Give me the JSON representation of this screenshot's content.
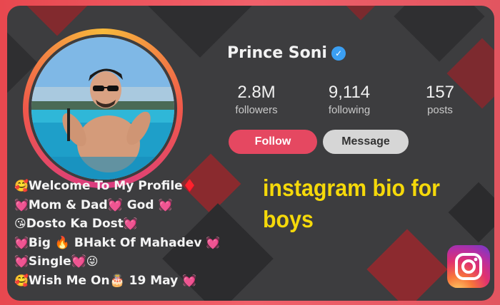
{
  "profile": {
    "username": "Prince Soni",
    "verified_icon": "verified-badge-icon"
  },
  "stats": [
    {
      "value": "2.8M",
      "label": "followers"
    },
    {
      "value": "9,114",
      "label": "following"
    },
    {
      "value": "157",
      "label": "posts"
    }
  ],
  "actions": {
    "follow_label": "Follow",
    "message_label": "Message"
  },
  "bio": {
    "lines": [
      {
        "lead": "🥰",
        "text": "Welcome To My Profile",
        "trail": "♦️"
      },
      {
        "lead": "💓",
        "text": "Mom & Dad💓 God ",
        "trail": "💓"
      },
      {
        "lead": "😘",
        "text": "Dosto Ka Dost",
        "trail": "💓"
      },
      {
        "lead": "💓",
        "text": "Big 🔥 BHakt Of Mahadev ",
        "trail": "💓"
      },
      {
        "lead": "💓",
        "text": "Single💓",
        "trail": "😜"
      },
      {
        "lead": "🥰",
        "text": "Wish Me On🎂 19 May ",
        "trail": "💓"
      }
    ]
  },
  "headline": {
    "line1": "instagram bio for",
    "line2": "boys"
  },
  "logo": {
    "icon": "instagram-logo-icon"
  },
  "colors": {
    "frame": "#e8484f",
    "card": "#3d3d3f",
    "follow": "#e54861",
    "message": "#d6d6d6",
    "headline": "#f5d90a",
    "verified": "#3b9ff2"
  }
}
